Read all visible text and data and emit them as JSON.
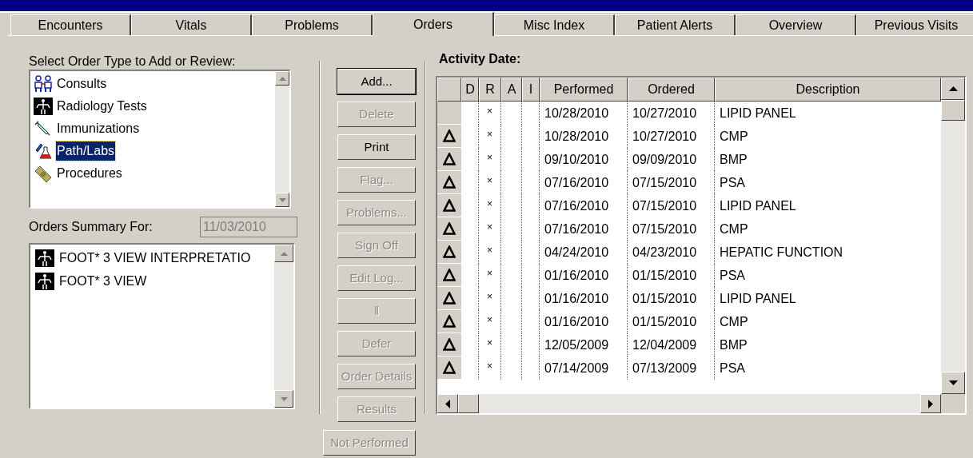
{
  "tabs": [
    {
      "label": "Encounters",
      "selected": false
    },
    {
      "label": "Vitals",
      "selected": false
    },
    {
      "label": "Problems",
      "selected": false
    },
    {
      "label": "Orders",
      "selected": true
    },
    {
      "label": "Misc Index",
      "selected": false
    },
    {
      "label": "Patient Alerts",
      "selected": false
    },
    {
      "label": "Overview",
      "selected": false
    },
    {
      "label": "Previous Visits",
      "selected": false
    }
  ],
  "order_types": {
    "label": "Select Order Type to Add or Review:",
    "items": [
      {
        "label": "Consults",
        "kind": "consult",
        "selected": false
      },
      {
        "label": "Radiology Tests",
        "kind": "xray",
        "selected": false
      },
      {
        "label": "Immunizations",
        "kind": "syringe",
        "selected": false
      },
      {
        "label": "Path/Labs",
        "kind": "lab",
        "selected": true
      },
      {
        "label": "Procedures",
        "kind": "bandage",
        "selected": false
      }
    ]
  },
  "orders_summary": {
    "label": "Orders Summary For:",
    "date": "11/03/2010",
    "items": [
      {
        "label": "FOOT* 3 VIEW INTERPRETATIO",
        "kind": "xray"
      },
      {
        "label": "FOOT* 3 VIEW",
        "kind": "xray"
      }
    ]
  },
  "buttons": [
    {
      "label": "Add...",
      "disabled": false
    },
    {
      "label": "Delete",
      "disabled": true
    },
    {
      "label": "Print",
      "disabled": false
    },
    {
      "label": "Flag...",
      "disabled": true
    },
    {
      "label": "Problems...",
      "disabled": true
    },
    {
      "label": "Sign Off",
      "disabled": true
    },
    {
      "label": "Edit Log...",
      "disabled": true
    },
    {
      "label": "ǁ",
      "disabled": true
    },
    {
      "label": "Defer",
      "disabled": true
    },
    {
      "label": "Order Details",
      "disabled": true
    },
    {
      "label": "Results",
      "disabled": true
    },
    {
      "label": "Not Performed",
      "disabled": true
    }
  ],
  "activity": {
    "label": "Activity Date:",
    "columns": [
      "D",
      "R",
      "A",
      "I",
      "Performed",
      "Ordered",
      "Description"
    ],
    "rows": [
      {
        "alert": false,
        "r": "×",
        "performed": "10/28/2010",
        "ordered": "10/27/2010",
        "description": "LIPID PANEL"
      },
      {
        "alert": true,
        "r": "×",
        "performed": "10/28/2010",
        "ordered": "10/27/2010",
        "description": "CMP"
      },
      {
        "alert": true,
        "r": "×",
        "performed": "09/10/2010",
        "ordered": "09/09/2010",
        "description": "BMP"
      },
      {
        "alert": true,
        "r": "×",
        "performed": "07/16/2010",
        "ordered": "07/15/2010",
        "description": "PSA"
      },
      {
        "alert": true,
        "r": "×",
        "performed": "07/16/2010",
        "ordered": "07/15/2010",
        "description": "LIPID PANEL"
      },
      {
        "alert": true,
        "r": "×",
        "performed": "07/16/2010",
        "ordered": "07/15/2010",
        "description": "CMP"
      },
      {
        "alert": true,
        "r": "×",
        "performed": "04/24/2010",
        "ordered": "04/23/2010",
        "description": "HEPATIC FUNCTION"
      },
      {
        "alert": true,
        "r": "×",
        "performed": "01/16/2010",
        "ordered": "01/15/2010",
        "description": "PSA"
      },
      {
        "alert": true,
        "r": "×",
        "performed": "01/16/2010",
        "ordered": "01/15/2010",
        "description": "LIPID PANEL"
      },
      {
        "alert": true,
        "r": "×",
        "performed": "01/16/2010",
        "ordered": "01/15/2010",
        "description": "CMP"
      },
      {
        "alert": true,
        "r": "×",
        "performed": "12/05/2009",
        "ordered": "12/04/2009",
        "description": "BMP"
      },
      {
        "alert": true,
        "r": "×",
        "performed": "07/14/2009",
        "ordered": "07/13/2009",
        "description": "PSA"
      }
    ]
  }
}
